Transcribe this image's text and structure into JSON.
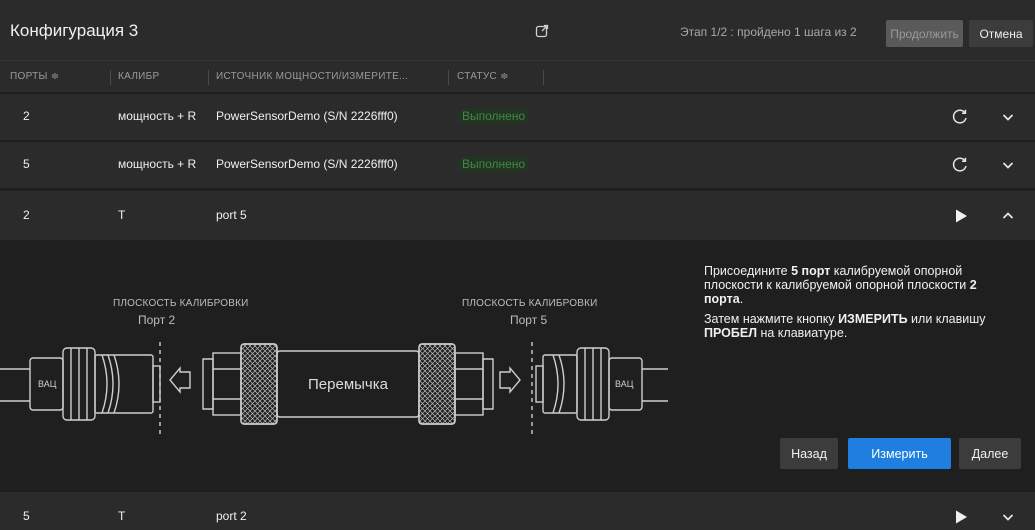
{
  "header": {
    "title": "Конфигурация 3",
    "step_text": "Этап 1/2 : пройдено 1 шага из 2",
    "continue_label": "Продолжить",
    "cancel_label": "Отмена"
  },
  "columns": {
    "ports": "ПОРТЫ ≑",
    "calibr": "КАЛИБР",
    "source": "ИСТОЧНИК МОЩНОСТИ/ИЗМЕРИТЕ...",
    "status": "СТАТУС ≑"
  },
  "rows": [
    {
      "port": "2",
      "calibr": "мощность + R",
      "source": "PowerSensorDemo (S/N 2226fff0)",
      "status": "Выполнено",
      "action_icon": "refresh-icon",
      "toggle_icon": "chevron-down-icon"
    },
    {
      "port": "5",
      "calibr": "мощность + R",
      "source": "PowerSensorDemo (S/N 2226fff0)",
      "status": "Выполнено",
      "action_icon": "refresh-icon",
      "toggle_icon": "chevron-down-icon"
    },
    {
      "port": "2",
      "calibr": "T",
      "source": "port 5",
      "status": "",
      "action_icon": "play-icon",
      "toggle_icon": "chevron-up-icon"
    },
    {
      "port": "5",
      "calibr": "T",
      "source": "port 2",
      "status": "",
      "action_icon": "play-icon",
      "toggle_icon": "chevron-down-icon"
    }
  ],
  "diagram": {
    "left_plane_label": "ПЛОСКОСТЬ КАЛИБРОВКИ",
    "left_port_label": "Порт 2",
    "right_plane_label": "ПЛОСКОСТЬ КАЛИБРОВКИ",
    "right_port_label": "Порт 5",
    "left_device_label": "ВАЦ",
    "right_device_label": "ВАЦ",
    "thru_label": "Перемычка"
  },
  "instructions": {
    "line1_a": "Присоедините ",
    "line1_b": "5 порт",
    "line1_c": " калибруемой опорной плоскости к калибруемой опорной плоскости ",
    "line1_d": "2 порта",
    "line1_e": ".",
    "line2_a": "Затем нажмите кнопку ",
    "line2_b": "ИЗМЕРИТЬ",
    "line2_c": " или клавишу ",
    "line2_d": "ПРОБЕЛ",
    "line2_e": " на клавиатуре."
  },
  "buttons": {
    "back_label": "Назад",
    "measure_label": "Измерить",
    "next_label": "Далее"
  },
  "colors": {
    "accent": "#1e7fe0",
    "status_done": "#3f8a3f",
    "panel": "#2b2b2b",
    "background": "#1f1f1f"
  }
}
